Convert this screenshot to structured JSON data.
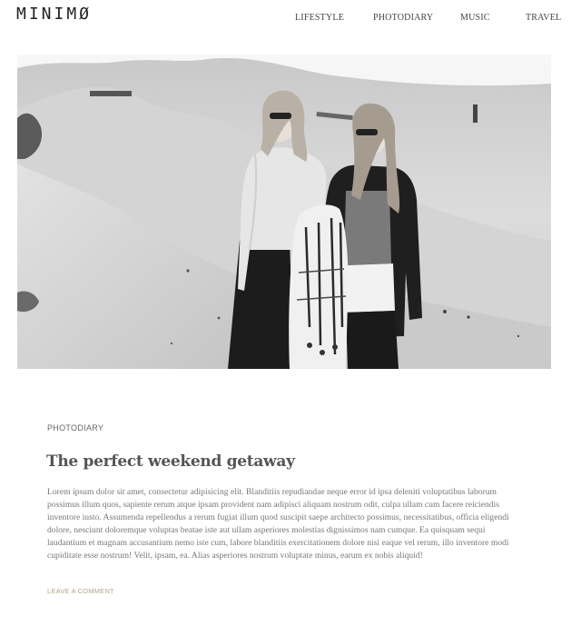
{
  "header": {
    "logo": "MINIMØ",
    "nav": [
      "LIFESTYLE",
      "PHOTODIARY",
      "MUSIC",
      "TRAVEL"
    ]
  },
  "post": {
    "category": "PHOTODIARY",
    "title": "The perfect weekend getaway",
    "excerpt": "Lorem ipsum dolor sit amet, consectetur adipisicing elit. Blanditiis repudiandae neque error id ipsa deleniti voluptatibus laborum possimus illum quos, sapiente rerum atque ipsam provident nam adipisci aliquam nostrum odit, culpa ullam cum facere reiciendis inventore iusto. Assumenda repellendus a rerum fugiat illum quod suscipit saepe architecto possimus, necessitatibus, officia eligendi dolore, nesciunt doloremque voluptas beatae iste aut ullam asperiores molestias dignissimos nam cumque. Ea quisquam sequi laudantium et magnam accusantium nemo iste cum, labore blanditiis exercitationem dolore nisi eaque vel rerum, illo inventore modi cupiditate esse nostrum! Velit, ipsam, ea. Alias asperiores nostrum voluptate minus, earum ex nobis aliquid!",
    "comment_link": "LEAVE A COMMENT",
    "image_tone": "black-and-white"
  }
}
